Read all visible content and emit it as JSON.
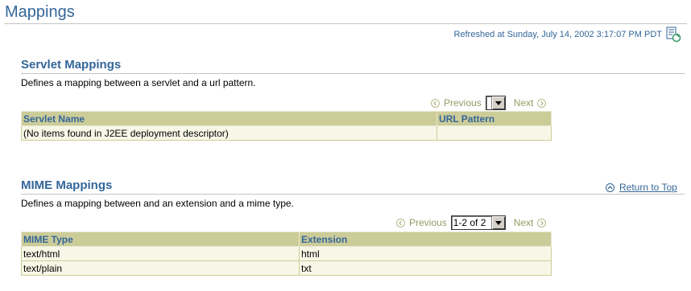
{
  "page": {
    "title": "Mappings",
    "refreshed": "Refreshed at Sunday, July 14, 2002 3:17:07 PM PDT"
  },
  "icons": {
    "refresh": "refresh-icon",
    "previous": "previous-arrow-icon",
    "next": "next-arrow-icon",
    "return_top": "return-top-icon",
    "dropdown": "dropdown-arrow-icon"
  },
  "colors": {
    "heading": "#336699",
    "table_header_bg": "#cccc99",
    "table_row_bg": "#f7f7e7",
    "nav_disabled": "#999966"
  },
  "servlet": {
    "title": "Servlet Mappings",
    "description": "Defines a mapping between a servlet and a url pattern.",
    "nav": {
      "previous": "Previous",
      "next": "Next",
      "selected": ""
    },
    "columns": [
      "Servlet Name",
      "URL Pattern"
    ],
    "rows": [
      [
        "(No items found in J2EE deployment descriptor)",
        ""
      ]
    ]
  },
  "mime": {
    "title": "MIME Mappings",
    "description": "Defines a mapping between and an extension and a mime type.",
    "return_top": "Return to Top",
    "nav": {
      "previous": "Previous",
      "next": "Next",
      "selected": "1-2 of 2"
    },
    "columns": [
      "MIME Type",
      "Extension"
    ],
    "rows": [
      [
        "text/html",
        "html"
      ],
      [
        "text/plain",
        "txt"
      ]
    ]
  }
}
